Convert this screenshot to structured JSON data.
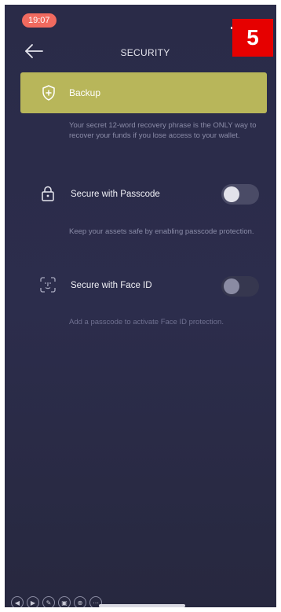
{
  "status_bar": {
    "time": "19:07"
  },
  "step_badge": "5",
  "header": {
    "title": "SECURITY",
    "back_icon": "arrow-left-icon"
  },
  "backup": {
    "label": "Backup",
    "icon": "shield-plus-icon",
    "description": "Your secret 12-word recovery phrase is the ONLY way to recover your funds if you lose access to your wallet."
  },
  "passcode": {
    "label": "Secure with Passcode",
    "icon": "lock-icon",
    "enabled": false,
    "description": "Keep your assets safe by enabling passcode protection."
  },
  "face_id": {
    "label": "Secure with Face ID",
    "icon": "face-id-icon",
    "enabled": false,
    "available": false,
    "description": "Add a passcode to activate Face ID protection."
  },
  "colors": {
    "background": "#2a2b48",
    "backup_card": "#b8b65a",
    "time_pill": "#f06a5f",
    "badge": "#e60000"
  }
}
